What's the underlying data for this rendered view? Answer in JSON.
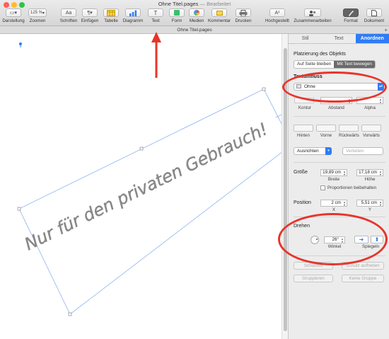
{
  "window": {
    "title": "Ohne Titel.pages",
    "edited": "— Bearbeitet",
    "tab_title": "Ohne Titel.pages"
  },
  "toolbar": {
    "view_label": "Darstellung",
    "zoom_value": "125 %",
    "zoom_label": "Zoomen",
    "fonts_label": "Schriften",
    "insert_label": "Einfügen",
    "table_label": "Tabelle",
    "chart_label": "Diagramm",
    "text_label": "Text",
    "shape_label": "Form",
    "media_label": "Medien",
    "comment_label": "Kommentar",
    "print_label": "Drucken",
    "superscript_label": "Hochgestellt",
    "collab_label": "Zusammenarbeiten",
    "format_label": "Format",
    "document_label": "Dokument",
    "fonts_glyph": "Aa",
    "insert_glyph": "¶",
    "text_glyph": "T",
    "superscript_glyph": "A¹"
  },
  "canvas": {
    "textbox_text": "Nur für den privaten Gebrauch!"
  },
  "inspector": {
    "tabs": [
      "Stil",
      "Text",
      "Anordnen"
    ],
    "placement_title": "Platzierung des Objekts",
    "stay_on_page": "Auf Seite bleiben",
    "move_with_text": "Mit Text bewegen",
    "wrap_title": "Textumfluss",
    "wrap_value": "Ohne",
    "contour_label": "Kontur",
    "spacing_label": "Abstand",
    "alpha_label": "Alpha",
    "back_label": "Hinten",
    "front_label": "Vorne",
    "backward_label": "Rückwärts",
    "forward_label": "Vorwärts",
    "align_label": "Ausrichten",
    "distribute_label": "Verteilen",
    "size_title": "Größe",
    "width_value": "19,89 cm",
    "width_label": "Breite",
    "height_value": "17,18 cm",
    "height_label": "Höhe",
    "keep_proportions": "Proportionen beibehalten",
    "position_title": "Position",
    "x_value": "2 cm",
    "x_label": "X",
    "y_value": "5,51 cm",
    "y_label": "Y",
    "rotate_title": "Drehen",
    "angle_value": "26°",
    "angle_label": "Winkel",
    "mirror_label": "Spiegeln",
    "lock_label": "Schützen",
    "unlock_label": "Schutz aufheben",
    "group_label": "Gruppieren",
    "ungroup_label": "Keine Gruppe"
  },
  "colors": {
    "accent": "#2f7cf6",
    "annotation_red": "#e8342a",
    "watermark_text": "#8a8a8a"
  }
}
